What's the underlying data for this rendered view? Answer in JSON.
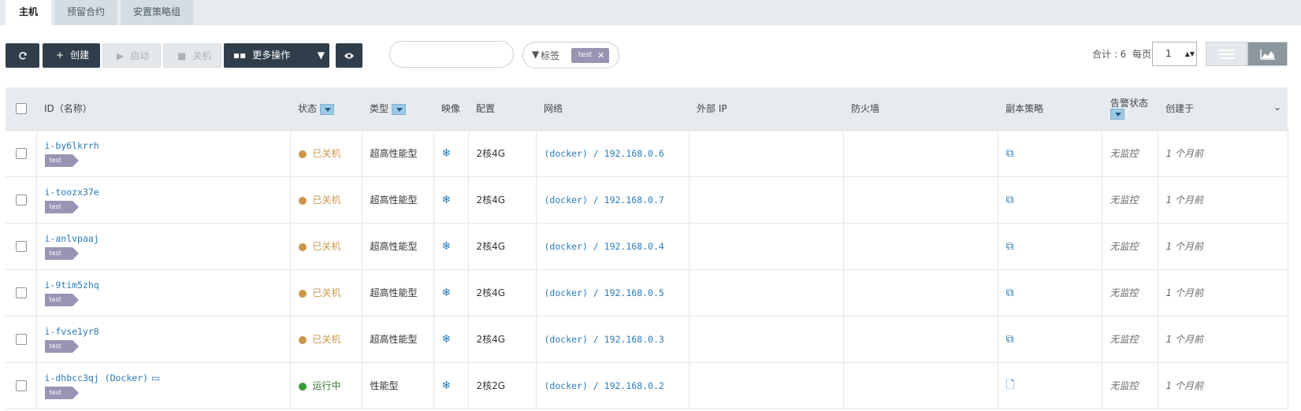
{
  "tabs": [
    {
      "label": "主机",
      "active": true
    },
    {
      "label": "预留合约",
      "active": false
    },
    {
      "label": "安置策略组",
      "active": false
    }
  ],
  "toolbar": {
    "refresh_icon": "refresh-icon",
    "create_label": "创建",
    "start_label": "启动",
    "shutdown_label": "关机",
    "more_label": "更多操作",
    "eye_icon": "eye-icon"
  },
  "search": {
    "placeholder": ""
  },
  "tag_filter": {
    "label": "标签",
    "chip": "test"
  },
  "pager": {
    "total_label": "合计 : 6",
    "per_page_label": "每页:",
    "page_value": "1"
  },
  "table": {
    "headers": {
      "id": "ID（名称）",
      "status": "状态",
      "type": "类型",
      "image": "映像",
      "config": "配置",
      "network": "网络",
      "external_ip": "外部 IP",
      "firewall": "防火墙",
      "backup": "副本策略",
      "alarm": "告警状态",
      "created": "创建于"
    },
    "rows": [
      {
        "id": "i-by6lkrrh",
        "tag": "test",
        "status": "已关机",
        "type": "超高性能型",
        "config": "2核4G",
        "network": "(docker) / 192.168.0.6",
        "alarm": "无监控",
        "created": "1 个月前"
      },
      {
        "id": "i-toozx37e",
        "tag": "test",
        "status": "已关机",
        "type": "超高性能型",
        "config": "2核4G",
        "network": "(docker) / 192.168.0.7",
        "alarm": "无监控",
        "created": "1 个月前"
      },
      {
        "id": "i-anlvpaaj",
        "tag": "test",
        "status": "已关机",
        "type": "超高性能型",
        "config": "2核4G",
        "network": "(docker) / 192.168.0.4",
        "alarm": "无监控",
        "created": "1 个月前"
      },
      {
        "id": "i-9tim5zhq",
        "tag": "test",
        "status": "已关机",
        "type": "超高性能型",
        "config": "2核4G",
        "network": "(docker) / 192.168.0.5",
        "alarm": "无监控",
        "created": "1 个月前"
      },
      {
        "id": "i-fvse1yr8",
        "tag": "test",
        "status": "已关机",
        "type": "超高性能型",
        "config": "2核4G",
        "network": "(docker) / 192.168.0.3",
        "alarm": "无监控",
        "created": "1 个月前"
      },
      {
        "id": "i-dhbcc3qj (Docker)",
        "tag": "test",
        "status": "运行中",
        "type": "性能型",
        "config": "2核2G",
        "network": "(docker) / 192.168.0.2",
        "alarm": "无监控",
        "created": "1 个月前"
      }
    ]
  },
  "colors": {
    "stopped": "#c9974a",
    "running": "#3a9a3a",
    "link": "#2b7bb9",
    "dark_button": "#2f3e4a",
    "tag": "#9a93b3"
  }
}
